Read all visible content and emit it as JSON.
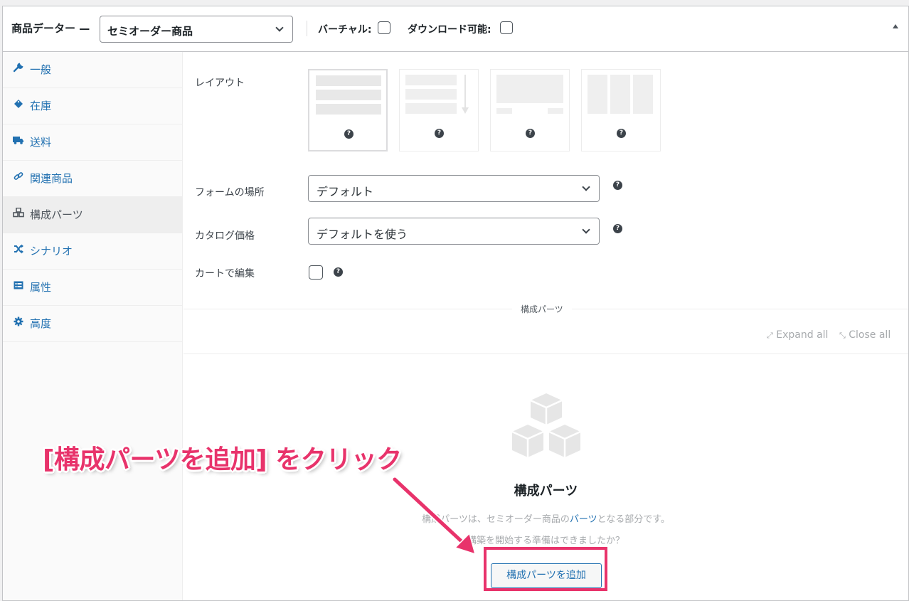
{
  "header": {
    "title": "商品データー —",
    "product_type": "セミオーダー商品",
    "virtual_label": "バーチャル:",
    "downloadable_label": "ダウンロード可能:"
  },
  "sidebar": {
    "items": [
      {
        "label": "一般",
        "icon": "wrench-icon"
      },
      {
        "label": "在庫",
        "icon": "tag-icon"
      },
      {
        "label": "送料",
        "icon": "truck-icon"
      },
      {
        "label": "関連商品",
        "icon": "link-icon"
      },
      {
        "label": "構成パーツ",
        "icon": "cubes-icon",
        "active": true
      },
      {
        "label": "シナリオ",
        "icon": "shuffle-icon"
      },
      {
        "label": "属性",
        "icon": "list-icon"
      },
      {
        "label": "高度",
        "icon": "gear-icon"
      }
    ]
  },
  "main": {
    "layout_label": "レイアウト",
    "form_location_label": "フォームの場所",
    "form_location_value": "デフォルト",
    "catalog_price_label": "カタログ価格",
    "catalog_price_value": "デフォルトを使う",
    "edit_in_cart_label": "カートで編集",
    "components_section_title": "構成パーツ",
    "expand_all": "Expand all",
    "close_all": "Close all",
    "empty_title": "構成パーツ",
    "empty_desc_1_pre": "構成パーツは、セミオーダー商品の",
    "empty_desc_1_link": "パーツ",
    "empty_desc_1_post": "となる部分です。",
    "empty_desc_2": "構築を開始する準備はできましたか？",
    "add_button": "構成パーツを追加"
  },
  "annotation": {
    "callout": "[構成パーツを追加] をクリック",
    "color": "#e8336b"
  }
}
